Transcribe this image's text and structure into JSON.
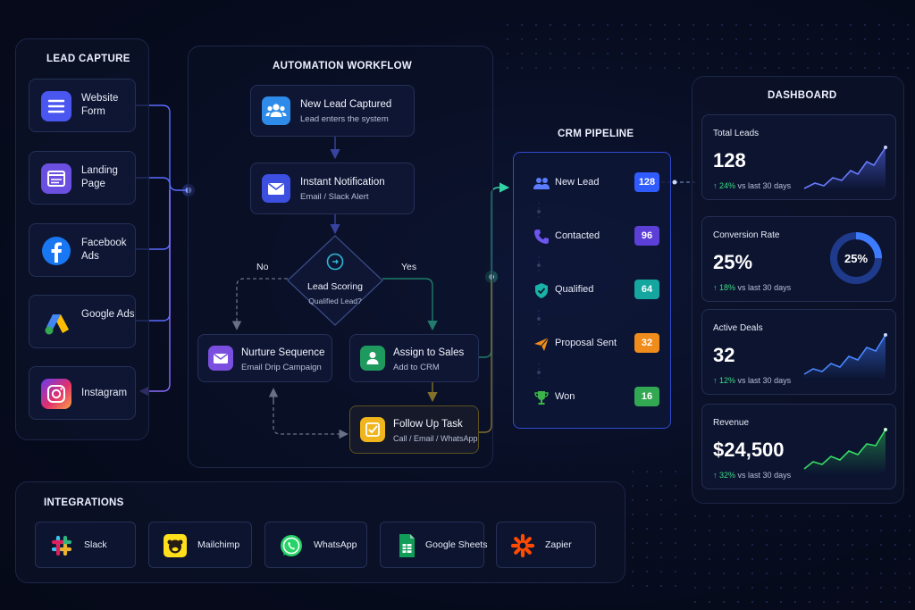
{
  "lead_capture": {
    "title": "LEAD CAPTURE",
    "items": [
      {
        "label": "Website Form",
        "icon": "form-icon"
      },
      {
        "label": "Landing Page",
        "icon": "page-icon"
      },
      {
        "label": "Facebook Ads",
        "icon": "facebook-icon"
      },
      {
        "label": "Google Ads",
        "icon": "google-ads-icon"
      },
      {
        "label": "Instagram",
        "icon": "instagram-icon"
      }
    ]
  },
  "workflow": {
    "title": "AUTOMATION WORKFLOW",
    "new_lead": {
      "title": "New Lead Captured",
      "subtitle": "Lead enters the system"
    },
    "notification": {
      "title": "Instant Notification",
      "subtitle": "Email / Slack Alert"
    },
    "scoring": {
      "title": "Lead Scoring",
      "subtitle": "Qualified Lead?"
    },
    "no_label": "No",
    "yes_label": "Yes",
    "nurture": {
      "title": "Nurture Sequence",
      "subtitle": "Email Drip Campaign"
    },
    "assign": {
      "title": "Assign to Sales",
      "subtitle": "Add to CRM"
    },
    "follow_up": {
      "title": "Follow Up Task",
      "subtitle": "Call / Email / WhatsApp"
    }
  },
  "crm": {
    "title": "CRM PIPELINE",
    "stages": [
      {
        "label": "New Lead",
        "count": "128",
        "color": "#2f5bff"
      },
      {
        "label": "Contacted",
        "count": "96",
        "color": "#5b3fd6"
      },
      {
        "label": "Qualified",
        "count": "64",
        "color": "#16a6a0"
      },
      {
        "label": "Proposal Sent",
        "count": "32",
        "color": "#f08c1c"
      },
      {
        "label": "Won",
        "count": "16",
        "color": "#33a852"
      }
    ]
  },
  "dashboard": {
    "title": "DASHBOARD",
    "metrics": [
      {
        "title": "Total Leads",
        "value": "128",
        "delta": "24%",
        "period": "vs last 30 days",
        "color": "#5b6cff"
      },
      {
        "title": "Conversion Rate",
        "value": "25%",
        "delta": "18%",
        "period": "vs last 30 days",
        "donut_label": "25%",
        "donut_fraction": 0.25,
        "color": "#3d7bff"
      },
      {
        "title": "Active Deals",
        "value": "32",
        "delta": "12%",
        "period": "vs last 30 days",
        "color": "#3d7bff"
      },
      {
        "title": "Revenue",
        "value": "$24,500",
        "delta": "32%",
        "period": "vs last 30 days",
        "color": "#2fd35a"
      }
    ]
  },
  "integrations": {
    "title": "INTEGRATIONS",
    "items": [
      {
        "label": "Slack",
        "icon": "slack-icon"
      },
      {
        "label": "Mailchimp",
        "icon": "mailchimp-icon"
      },
      {
        "label": "WhatsApp",
        "icon": "whatsapp-icon"
      },
      {
        "label": "Google Sheets",
        "icon": "google-sheets-icon"
      },
      {
        "label": "Zapier",
        "icon": "zapier-icon"
      }
    ]
  }
}
